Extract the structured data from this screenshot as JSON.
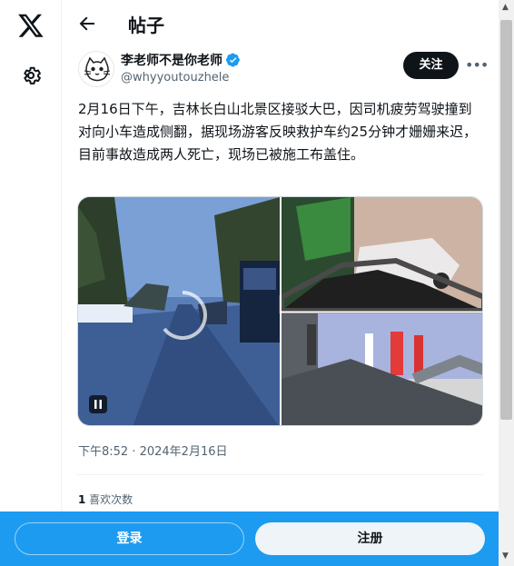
{
  "nav": {
    "logo_icon": "x-logo-icon",
    "settings_icon": "gear-icon"
  },
  "header": {
    "back_icon": "arrow-left-icon",
    "title": "帖子"
  },
  "author": {
    "display_name": "李老师不是你老师",
    "handle": "@whyyoutouzhele",
    "verified_icon": "verified-badge-icon",
    "follow_label": "关注",
    "more_icon": "more-icon"
  },
  "post": {
    "text": "2月16日下午，吉林长白山北景区接驳大巴，因司机疲劳驾驶撞到对向小车造成侧翻，据现场游客反映救护车约25分钟才姗姗来迟，目前事故造成两人死亡，现场已被施工布盖住。",
    "media_count": 3,
    "timestamp": "下午8:52 · 2024年2月16日",
    "like_count": "1",
    "like_label": " 喜欢次数"
  },
  "bottom_bar": {
    "login_label": "登录",
    "signup_label": "注册"
  },
  "colors": {
    "accent": "#1d9bf0",
    "text": "#0f1419",
    "secondary": "#536471"
  }
}
